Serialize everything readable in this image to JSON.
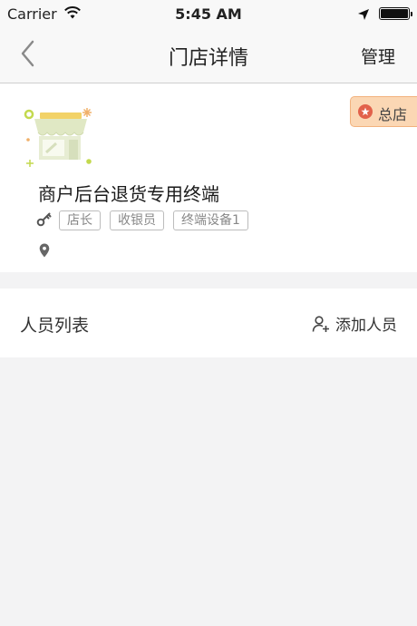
{
  "status_bar": {
    "carrier": "Carrier",
    "time": "5:45 AM",
    "icons": [
      "wifi-icon",
      "location-arrow-icon",
      "battery-icon"
    ]
  },
  "nav": {
    "title": "门店详情",
    "right_action": "管理",
    "back_icon": "chevron-left-icon"
  },
  "store": {
    "badge": "总店",
    "name": "商户后台退货专用终端",
    "tags": [
      "店长",
      "收银员",
      "终端设备1"
    ],
    "icons": [
      "store-icon",
      "key-icon",
      "location-pin-icon",
      "star-icon"
    ],
    "colors": {
      "badge_bg": "#fbd7b4",
      "badge_star": "#e2614a"
    }
  },
  "staff": {
    "title": "人员列表",
    "add_label": "添加人员",
    "add_icon": "add-user-icon"
  }
}
